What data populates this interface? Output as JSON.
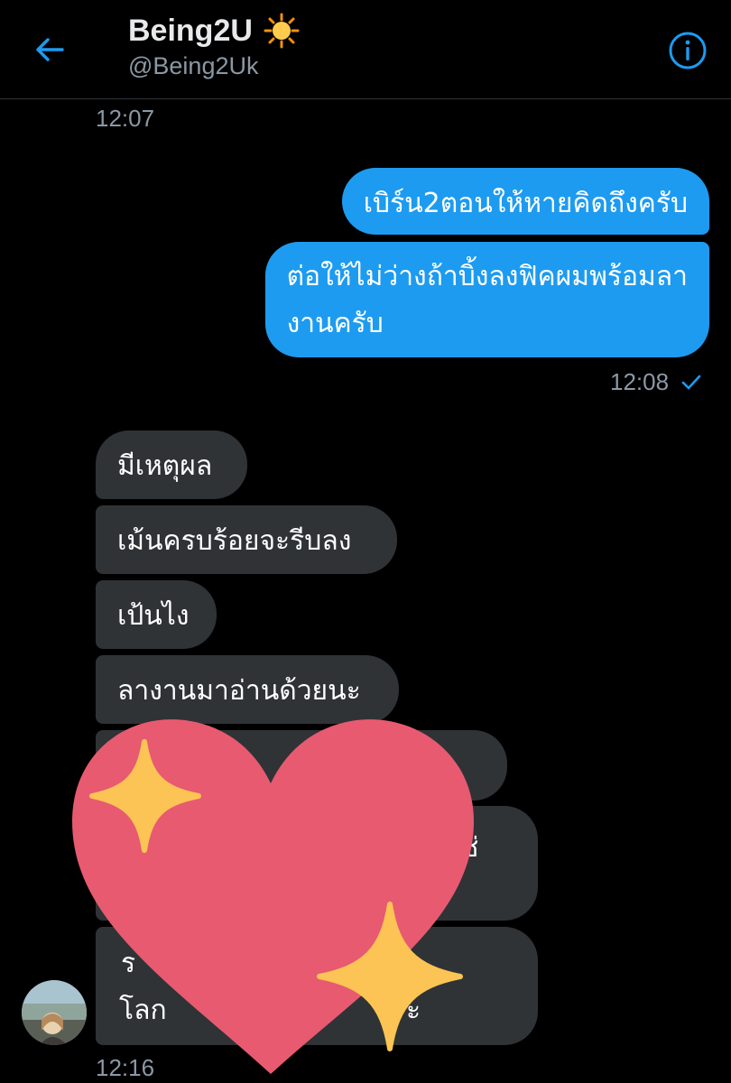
{
  "header": {
    "title": "Being2U",
    "handle": "@Being2Uk",
    "title_emoji_icon": "sun-emoji-icon",
    "back_icon": "back-arrow-icon",
    "info_icon": "info-icon"
  },
  "timestamps": {
    "first": "12:07",
    "sent": "12:08",
    "last": "12:16"
  },
  "sent_messages": [
    "เบิร์น2ตอนให้หายคิดถึงครับ",
    "ต่อให้ไม่ว่างถ้าบิ้งลงฟิคผมพร้อมลา",
    "งานครับ"
  ],
  "received_messages": [
    "มีเหตุผล",
    "เม้นครบร้อยจะรีบลง",
    "เป้นไง",
    "ลางานมาอ่านด้วยนะ",
    "",
    "ช่",
    "ร",
    "โลก",
    "ะ"
  ],
  "overlay": {
    "sticker_icon": "sparkling-heart-icon"
  },
  "colors": {
    "background": "#000000",
    "accent": "#1d9bf0",
    "received_bubble": "#2f3336",
    "secondary_text": "#8b98a5",
    "heart": "#e85a70",
    "sparkle": "#fcc454"
  }
}
